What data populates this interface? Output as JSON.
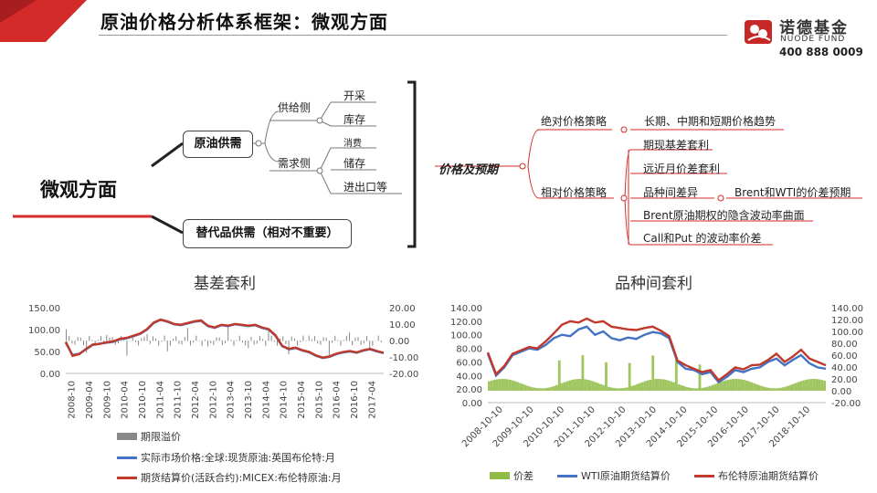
{
  "slide": {
    "title": "原油价格分析体系框架：微观方面",
    "brand": {
      "name": "诺德基金",
      "en": "NUODE FUND",
      "tel": "400 888 0009"
    }
  },
  "mindmap": {
    "root": "微观方面",
    "supply_demand": "原油供需",
    "substitute": "替代品供需（相对不重要）",
    "supply_side": "供给侧",
    "demand_side": "需求侧",
    "supply_items": [
      "开采",
      "库存"
    ],
    "demand_items": [
      "消费",
      "储存",
      "进出口等"
    ],
    "center": "价格及预期",
    "absolute": "绝对价格策略",
    "absolute_item": "长期、中期和短期价格趋势",
    "relative": "相对价格策略",
    "relative_items": [
      "期现基差套利",
      "远近月价差套利",
      "品种间差异",
      "Brent原油期权的隐含波动率曲面",
      "Call和Put 的波动率价差"
    ],
    "variety_sub": "Brent和WTI的价差预期"
  },
  "colors": {
    "red": "#c0392b",
    "blue": "#4472c4",
    "green": "#8fbc45",
    "gray": "#888888"
  },
  "chart_data": [
    {
      "type": "line",
      "title": "基差套利",
      "x_ticks": [
        "2008-10",
        "2009-04",
        "2009-10",
        "2010-04",
        "2010-10",
        "2011-04",
        "2011-10",
        "2012-04",
        "2012-10",
        "2013-04",
        "2013-10",
        "2014-04",
        "2014-10",
        "2015-04",
        "2015-10",
        "2016-04",
        "2016-10",
        "2017-04"
      ],
      "y_left_ticks": [
        "0.00",
        "50.00",
        "100.00",
        "150.00"
      ],
      "y_left_range": [
        0,
        150
      ],
      "y_right_ticks": [
        "-20.00",
        "-10.00",
        "0.00",
        "10.00",
        "20.00"
      ],
      "y_right_range": [
        -20,
        20
      ],
      "series": [
        {
          "name": "期限溢价",
          "kind": "bar",
          "axis": "right"
        },
        {
          "name": "实际市场价格:全球:现货原油:英国布伦特:月",
          "kind": "line",
          "values": [
            70,
            42,
            45,
            55,
            65,
            68,
            70,
            72,
            78,
            80,
            85,
            90,
            100,
            115,
            122,
            118,
            112,
            110,
            114,
            118,
            120,
            108,
            104,
            110,
            108,
            112,
            110,
            108,
            110,
            104,
            100,
            86,
            62,
            55,
            58,
            52,
            48,
            40,
            35,
            38,
            44,
            48,
            50,
            47,
            52,
            55,
            50,
            46
          ]
        },
        {
          "name": "期货结算价(活跃合约):MICEX:布伦特原油:月",
          "kind": "line",
          "values": [
            72,
            40,
            44,
            56,
            66,
            67,
            71,
            73,
            79,
            81,
            86,
            91,
            101,
            116,
            123,
            119,
            113,
            111,
            115,
            119,
            121,
            109,
            105,
            111,
            109,
            113,
            111,
            109,
            111,
            105,
            101,
            87,
            63,
            56,
            59,
            53,
            49,
            41,
            36,
            39,
            45,
            49,
            51,
            48,
            53,
            56,
            51,
            47
          ]
        }
      ]
    },
    {
      "type": "line",
      "title": "品种间套利",
      "x_ticks": [
        "2008-10-10",
        "2009-10-10",
        "2010-10-10",
        "2011-10-10",
        "2012-10-10",
        "2013-10-10",
        "2014-10-10",
        "2015-10-10",
        "2016-10-10",
        "2017-10-10",
        "2018-10-10"
      ],
      "y_left_ticks": [
        "0.00",
        "20.00",
        "40.00",
        "60.00",
        "80.00",
        "100.00",
        "120.00",
        "140.00"
      ],
      "y_left_range": [
        0,
        140
      ],
      "y_right_ticks": [
        "-20.00",
        "0.00",
        "20.00",
        "40.00",
        "60.00",
        "80.00",
        "100.00",
        "120.00",
        "140.00"
      ],
      "y_right_range": [
        -20,
        140
      ],
      "series": [
        {
          "name": "价差",
          "kind": "area",
          "axis": "right"
        },
        {
          "name": "WTI原油期货结算价",
          "kind": "line",
          "values": [
            72,
            40,
            52,
            70,
            75,
            80,
            78,
            85,
            95,
            100,
            98,
            108,
            112,
            100,
            105,
            95,
            92,
            96,
            94,
            100,
            104,
            102,
            95,
            60,
            50,
            48,
            42,
            45,
            30,
            38,
            48,
            45,
            50,
            52,
            60,
            65,
            55,
            63,
            70,
            58,
            52,
            50
          ]
        },
        {
          "name": "布伦特原油期货结算价",
          "kind": "line",
          "values": [
            74,
            42,
            54,
            72,
            77,
            82,
            80,
            90,
            102,
            115,
            120,
            118,
            124,
            118,
            120,
            112,
            110,
            108,
            107,
            110,
            112,
            106,
            98,
            62,
            55,
            50,
            45,
            48,
            33,
            42,
            52,
            49,
            55,
            56,
            63,
            72,
            60,
            68,
            78,
            65,
            60,
            55
          ]
        }
      ]
    }
  ]
}
